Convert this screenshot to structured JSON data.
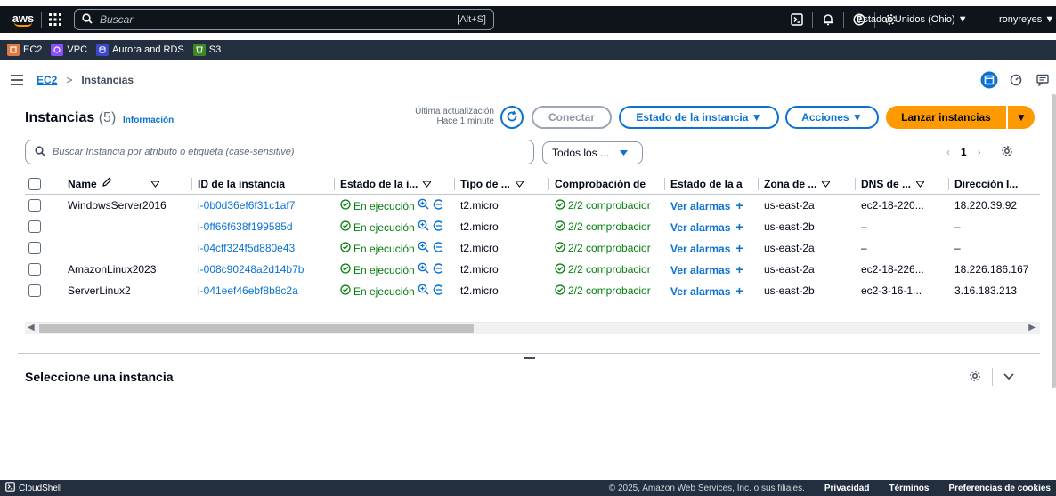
{
  "topnav": {
    "logo_text": "aws",
    "search_placeholder": "Buscar",
    "search_shortcut": "[Alt+S]",
    "region_label": "Estados Unidos (Ohio) ▼",
    "user_label": "ronyreyes ▼"
  },
  "services": [
    {
      "label": "EC2",
      "color": "#e07941"
    },
    {
      "label": "VPC",
      "color": "#8c4fff"
    },
    {
      "label": "Aurora and RDS",
      "color": "#3b48cc"
    },
    {
      "label": "S3",
      "color": "#3f8624"
    }
  ],
  "breadcrumb": {
    "parent": "EC2",
    "separator": ">",
    "current": "Instancias"
  },
  "header": {
    "title": "Instancias",
    "count": "(5)",
    "info": "Información",
    "last_update_label": "Última actualización",
    "last_update_value": "Hace 1 minute"
  },
  "buttons": {
    "connect": "Conectar",
    "instance_state": "Estado de la instancia ▼",
    "actions": "Acciones ▼",
    "launch": "Lanzar instancias",
    "launch_caret": "▼"
  },
  "filter": {
    "placeholder": "Buscar Instancia por atributo o etiqueta (case-sensitive)",
    "state_select": "Todos los ...",
    "page": "1"
  },
  "columns": {
    "name": "Name",
    "id": "ID de la instancia",
    "state": "Estado de la i...",
    "type": "Tipo de ...",
    "check": "Comprobación de",
    "alarm": "Estado de la a",
    "zone": "Zona de ...",
    "dns": "DNS de ...",
    "ip": "Dirección I..."
  },
  "rows": [
    {
      "name": "WindowsServer2016",
      "id": "i-0b0d36ef6f31c1af7",
      "state": "En ejecución",
      "type": "t2.micro",
      "check": "2/2 comprobacior",
      "alarm": "Ver alarmas",
      "zone": "us-east-2a",
      "dns": "ec2-18-220...",
      "ip": "18.220.39.92"
    },
    {
      "name": "",
      "id": "i-0ff66f638f199585d",
      "state": "En ejecución",
      "type": "t2.micro",
      "check": "2/2 comprobacior",
      "alarm": "Ver alarmas",
      "zone": "us-east-2b",
      "dns": "–",
      "ip": "–"
    },
    {
      "name": "",
      "id": "i-04cff324f5d880e43",
      "state": "En ejecución",
      "type": "t2.micro",
      "check": "2/2 comprobacior",
      "alarm": "Ver alarmas",
      "zone": "us-east-2a",
      "dns": "–",
      "ip": "–"
    },
    {
      "name": "AmazonLinux2023",
      "id": "i-008c90248a2d14b7b",
      "state": "En ejecución",
      "type": "t2.micro",
      "check": "2/2 comprobacior",
      "alarm": "Ver alarmas",
      "zone": "us-east-2a",
      "dns": "ec2-18-226...",
      "ip": "18.226.186.167"
    },
    {
      "name": "ServerLinux2",
      "id": "i-041eef46ebf8b8c2a",
      "state": "En ejecución",
      "type": "t2.micro",
      "check": "2/2 comprobacior",
      "alarm": "Ver alarmas",
      "zone": "us-east-2b",
      "dns": "ec2-3-16-1...",
      "ip": "3.16.183.213"
    }
  ],
  "detail_panel": {
    "title": "Seleccione una instancia"
  },
  "footer": {
    "cloudshell": "CloudShell",
    "copyright": "© 2025, Amazon Web Services, Inc. o sus filiales.",
    "privacy": "Privacidad",
    "terms": "Términos",
    "cookies": "Preferencias de cookies"
  },
  "colors": {
    "nav_bg": "#0f141a",
    "services_bg": "#232f3e",
    "link": "#0972d3",
    "primary": "#ff9900",
    "success": "#037f0c"
  }
}
